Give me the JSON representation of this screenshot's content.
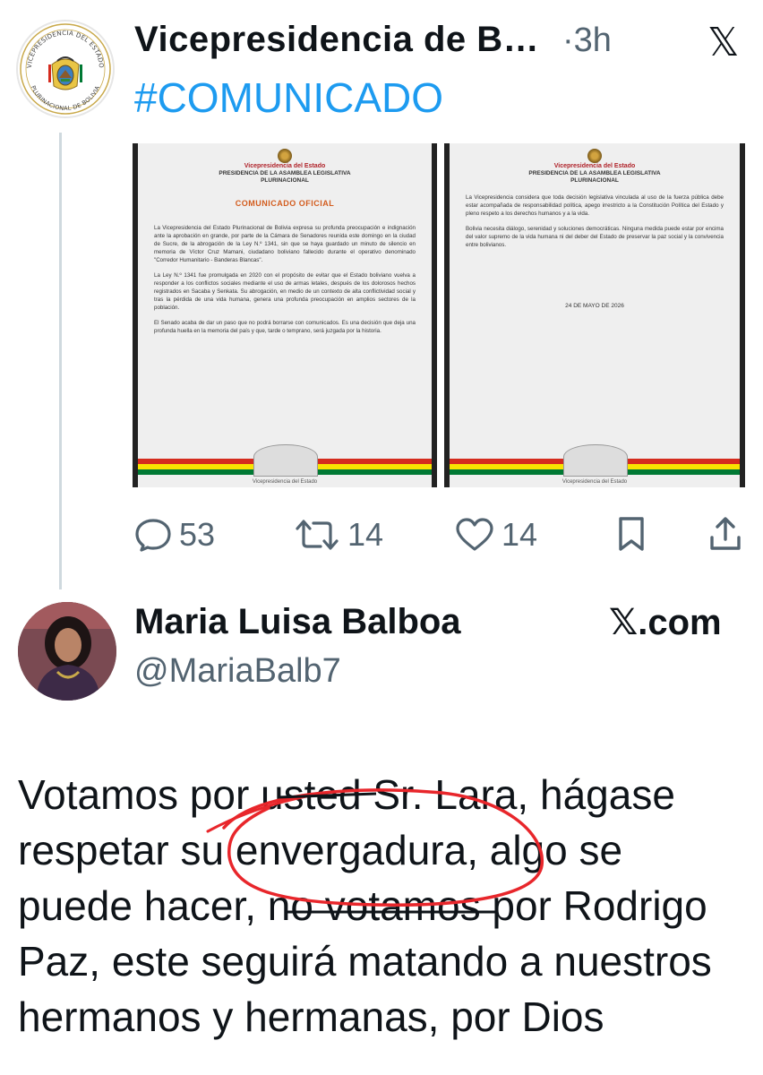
{
  "tweet": {
    "author_name": "Vicepresidencia de B…",
    "separator": "·",
    "time": "3h",
    "close_glyph": "𝕏",
    "hashtag": "#COMUNICADO",
    "seal_text_top": "VICEPRESIDENCIA DEL ESTADO",
    "seal_text_bottom": "PLURINACIONAL DE BOLIVIA"
  },
  "documents": [
    {
      "head1": "Vicepresidencia del Estado",
      "head2": "PRESIDENCIA DE LA ASAMBLEA LEGISLATIVA",
      "head3": "PLURINACIONAL",
      "title": "COMUNICADO OFICIAL",
      "paragraphs": [
        "La Vicepresidencia del Estado Plurinacional de Bolivia expresa su profunda preocupación e indignación ante la aprobación en grande, por parte de la Cámara de Senadores reunida este domingo en la ciudad de Sucre, de la abrogación de la Ley N.º 1341, sin que se haya guardado un minuto de silencio en memoria de Víctor Cruz Mamani, ciudadano boliviano fallecido durante el operativo denominado \"Corredor Humanitario - Banderas Blancas\".",
        "La Ley N.º 1341 fue promulgada en 2020 con el propósito de evitar que el Estado boliviano vuelva a responder a los conflictos sociales mediante el uso de armas letales, después de los dolorosos hechos registrados en Sacaba y Senkata. Su abrogación, en medio de un contexto de alta conflictividad social y tras la pérdida de una vida humana, genera una profunda preocupación en amplios sectores de la población.",
        "El Senado acaba de dar un paso que no podrá borrarse con comunicados. Es una decisión que deja una profunda huella en la memoria del país y que, tarde o temprano, será juzgada por la historia."
      ],
      "footer": "Vicepresidencia del Estado"
    },
    {
      "head1": "Vicepresidencia del Estado",
      "head2": "PRESIDENCIA DE LA ASAMBLEA LEGISLATIVA",
      "head3": "PLURINACIONAL",
      "paragraphs": [
        "La Vicepresidencia considera que toda decisión legislativa vinculada al uso de la fuerza pública debe estar acompañada de responsabilidad política, apego irrestricto a la Constitución Política del Estado y pleno respeto a los derechos humanos y a la vida.",
        "Bolivia necesita diálogo, serenidad y soluciones democráticas. Ninguna medida puede estar por encima del valor supremo de la vida humana ni del deber del Estado de preservar la paz social y la convivencia entre bolivianos."
      ],
      "date": "24 DE MAYO DE 2026",
      "footer": "Vicepresidencia del Estado"
    }
  ],
  "actions": {
    "replies": "53",
    "retweets": "14",
    "likes": "14"
  },
  "quoted": {
    "name": "Maria Luisa Balboa",
    "handle": "@MariaBalb7",
    "source": "𝕏.com",
    "lines": [
      "Votamos por usted Sr. Lara, hágase",
      "respetar su envergadura, algo se",
      "puede hacer, no votamos por Rodrigo",
      "Paz, este seguirá matando a nuestros",
      "hermanos y hermanas, por Dios"
    ]
  },
  "colors": {
    "accent": "#1d9bf0",
    "muted": "#536471",
    "annotation": "#e8262b"
  }
}
